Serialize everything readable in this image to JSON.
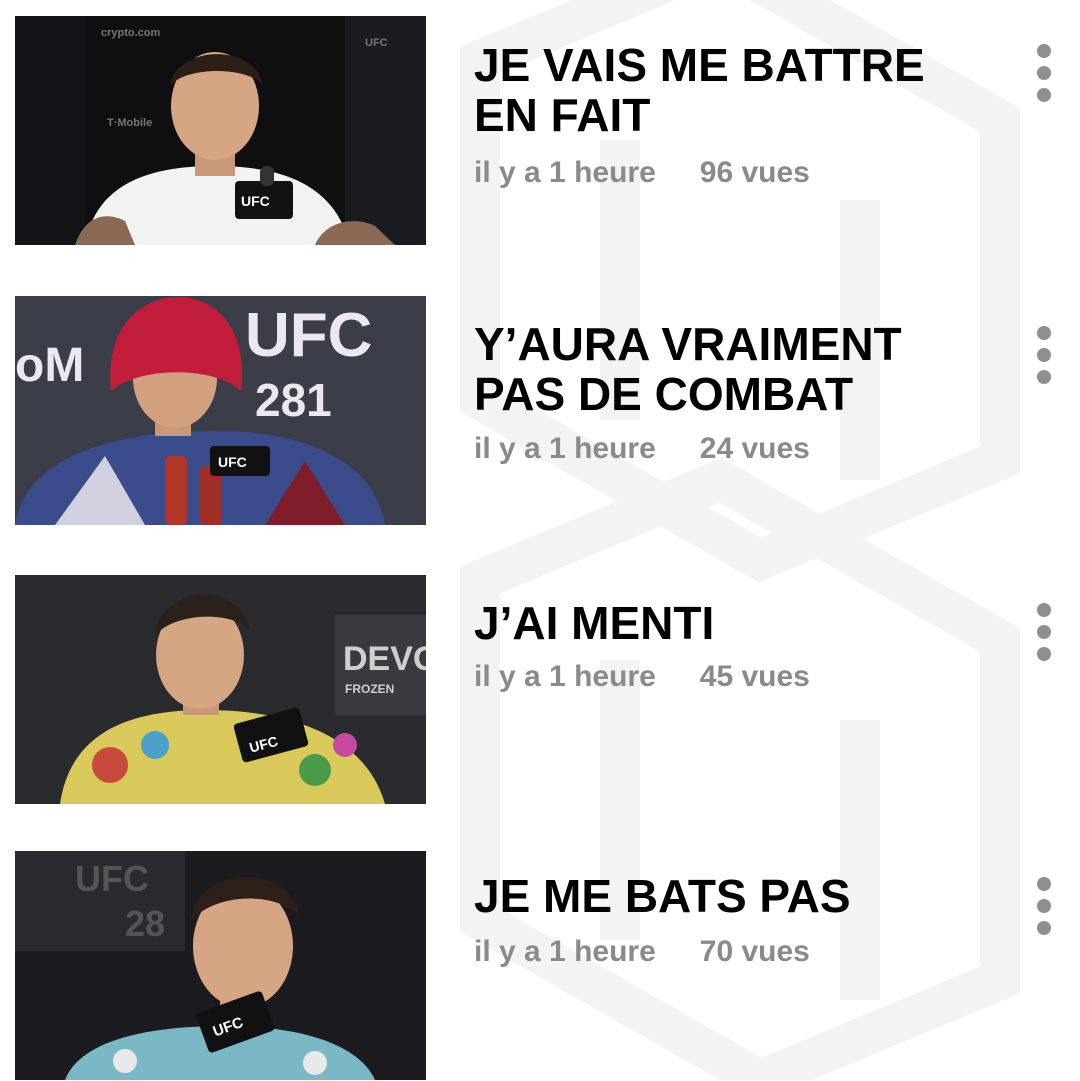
{
  "videos": [
    {
      "title_line1": "JE VAIS ME BATTRE",
      "title_line2": "EN FAIT",
      "time": "il y a 1 heure",
      "views": "96 vues",
      "thumbnail_bg": "#0f0f12",
      "shirt_color": "#f2f2f2",
      "hat_color": ""
    },
    {
      "title_line1": "Y’AURA VRAIMENT",
      "title_line2": "PAS DE COMBAT",
      "time": "il y a 1 heure",
      "views": "24 vues",
      "thumbnail_bg": "#3b3e48",
      "shirt_color": "#3a4c8c",
      "hat_color": "#c21e3c"
    },
    {
      "title_line1": "J’AI MENTI",
      "title_line2": "",
      "time": "il y a 1 heure",
      "views": "45 vues",
      "thumbnail_bg": "#2a2b2f",
      "shirt_color": "#d9c85a",
      "hat_color": ""
    },
    {
      "title_line1": "JE ME BATS PAS",
      "title_line2": "",
      "time": "il y a 1 heure",
      "views": "70 vues",
      "thumbnail_bg": "#1c1c20",
      "shirt_color": "#79b8c4",
      "hat_color": ""
    }
  ],
  "colors": {
    "title": "#000000",
    "meta": "#8a8a8a",
    "more_dots": "#8f8f8f",
    "watermark": "#f4f4f4"
  },
  "icons": {
    "more": "more-vertical-icon"
  }
}
